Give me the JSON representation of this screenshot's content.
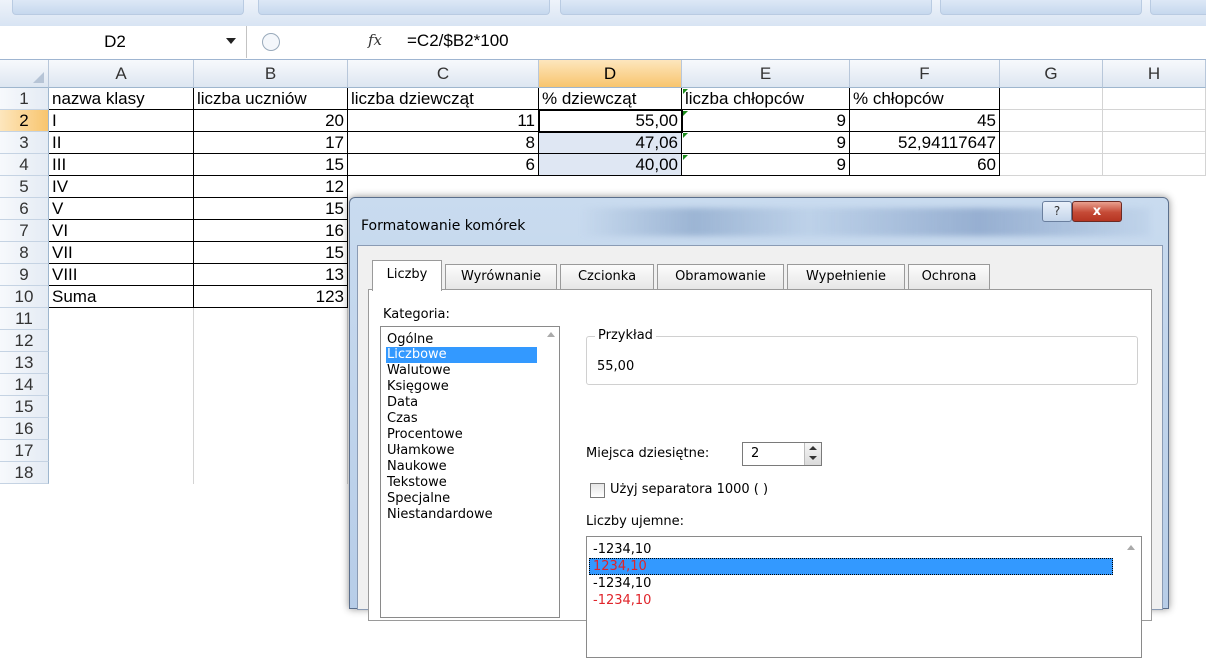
{
  "formula_bar": {
    "name_box": "D2",
    "fx_icon": "fx",
    "formula": "=C2/$B2*100"
  },
  "columns": [
    "A",
    "B",
    "C",
    "D",
    "E",
    "F",
    "G",
    "H"
  ],
  "rows": [
    "1",
    "2",
    "3",
    "4",
    "5",
    "6",
    "7",
    "8",
    "9",
    "10",
    "11",
    "12",
    "13",
    "14",
    "15",
    "16",
    "17",
    "18"
  ],
  "sheet": {
    "headers": [
      "nazwa klasy",
      "liczba uczniów",
      "liczba dziewcząt",
      "% dziewcząt",
      "liczba chłopców",
      "% chłopców"
    ],
    "data": [
      {
        "a": "I",
        "b": "20",
        "c": "11",
        "d": "55,00",
        "e": "9",
        "f": "45"
      },
      {
        "a": "II",
        "b": "17",
        "c": "8",
        "d": "47,06",
        "e": "9",
        "f": "52,94117647"
      },
      {
        "a": "III",
        "b": "15",
        "c": "6",
        "d": "40,00",
        "e": "9",
        "f": "60"
      },
      {
        "a": "IV",
        "b": "12"
      },
      {
        "a": "V",
        "b": "15"
      },
      {
        "a": "VI",
        "b": "16"
      },
      {
        "a": "VII",
        "b": "15"
      },
      {
        "a": "VIII",
        "b": "13"
      },
      {
        "a": "Suma",
        "b": "123"
      }
    ]
  },
  "dialog": {
    "title": "Formatowanie komórek",
    "help_label": "?",
    "close_label": "x",
    "tabs": [
      "Liczby",
      "Wyrównanie",
      "Czcionka",
      "Obramowanie",
      "Wypełnienie",
      "Ochrona"
    ],
    "category_label": "Kategoria:",
    "categories": [
      "Ogólne",
      "Liczbowe",
      "Walutowe",
      "Księgowe",
      "Data",
      "Czas",
      "Procentowe",
      "Ułamkowe",
      "Naukowe",
      "Tekstowe",
      "Specjalne",
      "Niestandardowe"
    ],
    "selected_category": "Liczbowe",
    "sample_label": "Przykład",
    "sample_value": "55,00",
    "decimals_label": "Miejsca dziesiętne:",
    "decimals_value": "2",
    "separator_label": "Użyj separatora 1000 ( )",
    "negative_label": "Liczby ujemne:",
    "negatives": [
      {
        "text": "-1234,10",
        "color": "#000000"
      },
      {
        "text": "1234,10",
        "color": "#e0242a"
      },
      {
        "text": "-1234,10",
        "color": "#000000"
      },
      {
        "text": "-1234,10",
        "color": "#e0242a"
      }
    ]
  }
}
